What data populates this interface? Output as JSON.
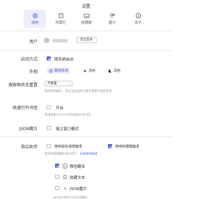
{
  "window": {
    "title": "设置"
  },
  "tabs": [
    {
      "label": "通用",
      "icon": "gear-icon",
      "active": true
    },
    {
      "label": "布局栏",
      "icon": "layout-icon",
      "active": false
    },
    {
      "label": "快捷键",
      "icon": "keyboard-icon",
      "active": false
    },
    {
      "label": "圈子",
      "icon": "group-icon",
      "active": false
    },
    {
      "label": "关于",
      "icon": "info-icon",
      "active": false
    }
  ],
  "user": {
    "label": "用户",
    "logout": "退出登录"
  },
  "startup": {
    "label": "启动方式",
    "option": "随系统启动",
    "checked": true
  },
  "appearance": {
    "label": "外观",
    "options": [
      {
        "label": "跟随系统",
        "icon": "auto-theme-icon",
        "active": true
      },
      {
        "label": "浅色",
        "icon": "sun-icon",
        "active": false
      },
      {
        "label": "深色",
        "icon": "moon-icon",
        "active": false
      }
    ]
  },
  "search_reset": {
    "label": "搜索框状态重置",
    "value": "不重置",
    "hint": "搜索框隐藏后，是否退出当前功能并重置为搜索状态"
  },
  "quick_bookmark": {
    "label": "快速打开书签",
    "option": "开启",
    "checked": false,
    "hint": "直接搜索Chrome浏览器保存的书签"
  },
  "json_magic": {
    "label": "JSON魔方",
    "option": "独立窗口模式",
    "checked": false
  },
  "finger_helper": {
    "label": "指尖助手",
    "opt_mouse": "使用鼠标滑按触发",
    "opt_mouse_checked": false,
    "opt_hotkey": "使用快捷键触发",
    "opt_hotkey_checked": true,
    "hint_prefix": "使用快捷键触发指尖助手，",
    "hint_link": "去修改快捷键",
    "items": [
      {
        "label": "微信翻译",
        "icon": "translate-icon",
        "checked": true
      },
      {
        "label": "收藏文本",
        "icon": "bookmark-icon",
        "checked": false
      },
      {
        "label": "JSON魔方",
        "icon": "json-icon",
        "checked": false
      }
    ],
    "footer": "选中JSON时打开JSON魔方"
  }
}
